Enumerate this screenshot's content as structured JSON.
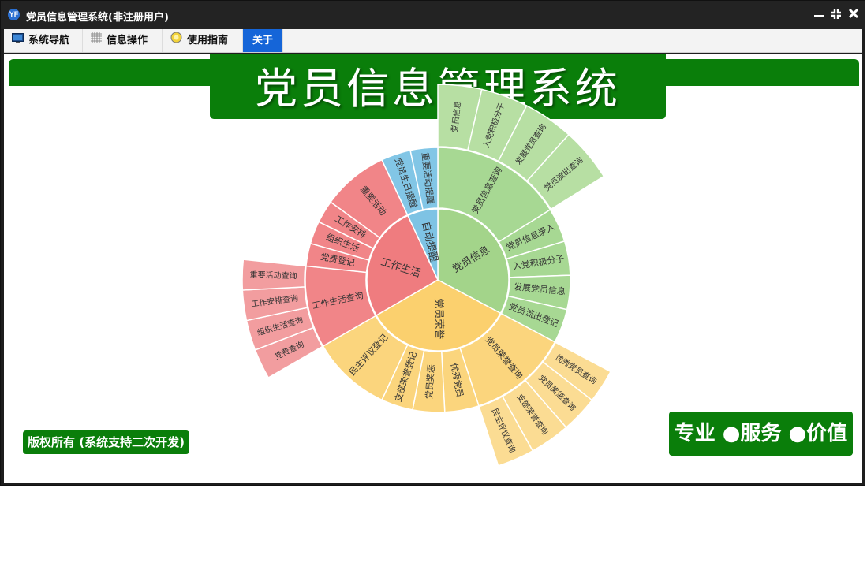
{
  "window": {
    "title": "党员信息管理系统(非注册用户)",
    "app_icon": "app-logo-icon",
    "buttons": [
      "minimize-icon",
      "restore-icon",
      "close-icon"
    ]
  },
  "menu": [
    {
      "label": "系统导航",
      "icon": "monitor-icon"
    },
    {
      "label": "信息操作",
      "icon": "grid-icon"
    },
    {
      "label": "使用指南",
      "icon": "bulb-icon"
    },
    {
      "label": "关于",
      "icon": "",
      "active": true
    }
  ],
  "banner": {
    "title": "党员信息管理系统"
  },
  "footer": {
    "copyright": "版权所有 (系统支持二次开发)",
    "slogan": "专业 ●服务 ●价值"
  },
  "colors": {
    "accent_green": "#0a7e0a",
    "menu_active": "#1565d8",
    "info_green": "#a3d48a",
    "honor_orange": "#fbd06e",
    "work_red": "#ef7c7f",
    "remind_blue": "#7ec3e4"
  },
  "chart_data": {
    "type": "sunburst",
    "categories": [
      {
        "name": "党员信息",
        "children": [
          {
            "name": "党员信息查询",
            "children": [
              {
                "name": "党员信息"
              },
              {
                "name": "入党积极分子"
              },
              {
                "name": "发展党员查询"
              },
              {
                "name": "党员流出查询"
              }
            ]
          },
          {
            "name": "党员信息录入"
          },
          {
            "name": "入党积极分子"
          },
          {
            "name": "发展党员信息"
          },
          {
            "name": "党员流出登记"
          }
        ]
      },
      {
        "name": "党员荣誉",
        "children": [
          {
            "name": "党员荣誉查询",
            "children": [
              {
                "name": "优秀党员查询"
              },
              {
                "name": "党员奖惩查询"
              },
              {
                "name": "支部荣誉查询"
              },
              {
                "name": "民主评议查询"
              }
            ]
          },
          {
            "name": "优秀党员"
          },
          {
            "name": "党员奖惩"
          },
          {
            "name": "支部荣誉登记"
          },
          {
            "name": "民主评议登记"
          }
        ]
      },
      {
        "name": "工作生活",
        "children": [
          {
            "name": "工作生活查询",
            "children": [
              {
                "name": "党费查询"
              },
              {
                "name": "组织生活查询"
              },
              {
                "name": "工作安排查询"
              },
              {
                "name": "重要活动查询"
              }
            ]
          },
          {
            "name": "党费登记"
          },
          {
            "name": "组织生活"
          },
          {
            "name": "工作安排"
          },
          {
            "name": "重要活动"
          }
        ]
      },
      {
        "name": "自动提醒",
        "children": [
          {
            "name": "党员生日提醒"
          },
          {
            "name": "重要活动提醒"
          }
        ]
      }
    ]
  }
}
